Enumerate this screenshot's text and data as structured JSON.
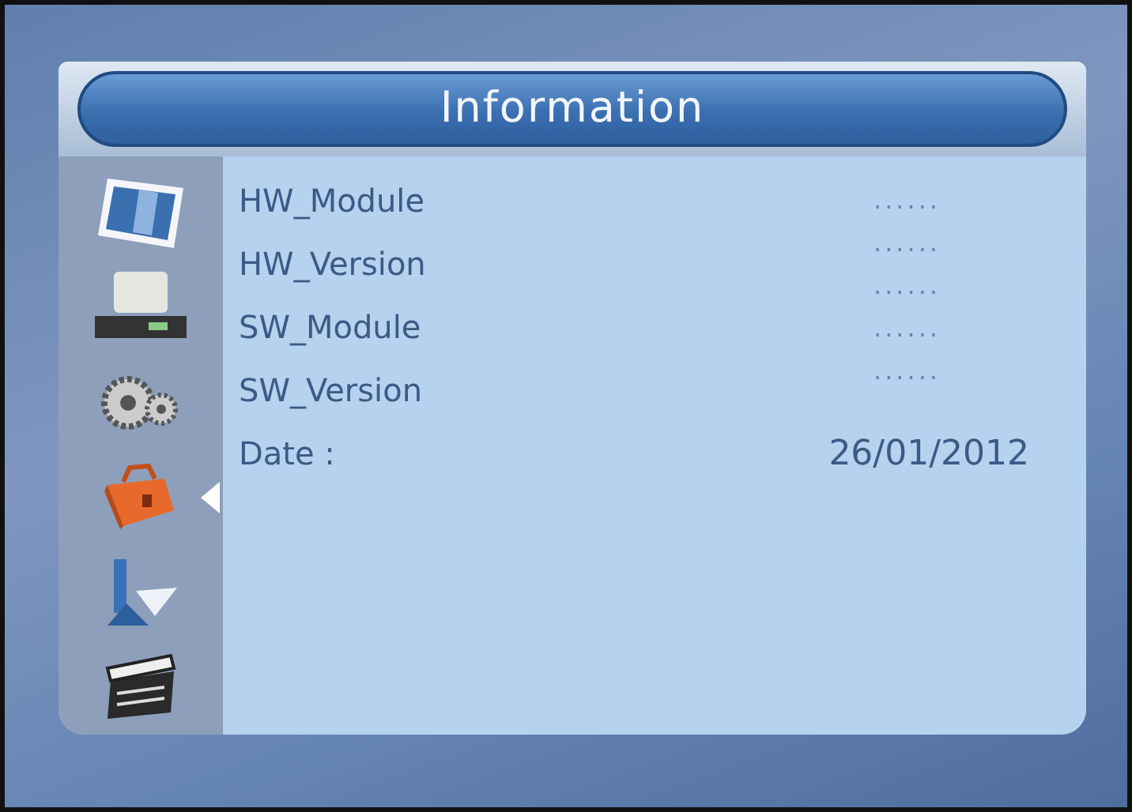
{
  "title": "Information",
  "sidebar": {
    "items": [
      {
        "kind": "monitor",
        "selected": false
      },
      {
        "kind": "receiver",
        "selected": false
      },
      {
        "kind": "gears",
        "selected": false
      },
      {
        "kind": "toolbox",
        "selected": true
      },
      {
        "kind": "pointer",
        "selected": false
      },
      {
        "kind": "clapper",
        "selected": false
      }
    ]
  },
  "labels": [
    "HW_Module",
    "HW_Version",
    "SW_Module",
    "SW_Version",
    "Date :"
  ],
  "values": [
    "......",
    "......",
    "......",
    "......",
    "......",
    "26/01/2012"
  ]
}
